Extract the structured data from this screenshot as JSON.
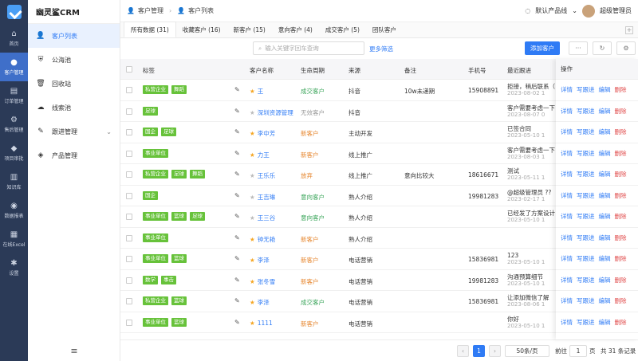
{
  "rail": [
    {
      "label": "首页",
      "icon": "⌂"
    },
    {
      "label": "客户管理",
      "icon": "●"
    },
    {
      "label": "订单管理",
      "icon": "▤"
    },
    {
      "label": "售后管理",
      "icon": "⚙"
    },
    {
      "label": "项目审批",
      "icon": "◆"
    },
    {
      "label": "知识库",
      "icon": "▥"
    },
    {
      "label": "数据报表",
      "icon": "◉"
    },
    {
      "label": "在线Excel",
      "icon": "▦"
    },
    {
      "label": "设置",
      "icon": "✱"
    }
  ],
  "brand": "幽灵鲨CRM",
  "menu": [
    {
      "label": "客户列表",
      "icon": "👤"
    },
    {
      "label": "公海池",
      "icon": "⛨"
    },
    {
      "label": "回收站",
      "icon": "🗑"
    },
    {
      "label": "线索池",
      "icon": "☁"
    },
    {
      "label": "跟进管理",
      "icon": "✎"
    },
    {
      "label": "产品管理",
      "icon": "◈"
    }
  ],
  "breadcrumb": [
    "客户管理",
    "客户列表"
  ],
  "product_line": "默认产品线",
  "user": "超级管理员",
  "tabs": [
    "所有数据 (31)",
    "收藏客户 (16)",
    "新客户 (15)",
    "意向客户 (4)",
    "成交客户 (5)",
    "团队客户"
  ],
  "search_placeholder": "输入关键字回车查询",
  "more_filter": "更多筛选",
  "add_button": "添加客户",
  "columns": {
    "tag": "标签",
    "name": "客户名称",
    "stage": "生命周期",
    "source": "来源",
    "note": "备注",
    "phone": "手机号",
    "last": "最近跟进",
    "ops": "操作"
  },
  "rows": [
    {
      "tags": [
        "私营企业",
        "舞蹈"
      ],
      "star": true,
      "name": "王",
      "stage": "成交客户",
      "stage_color": "green",
      "source": "抖音",
      "note": "10w未递期",
      "phone": "15908891",
      "last": "拒接，稍后联系（",
      "last_date": "2023-08-02 1"
    },
    {
      "tags": [
        "足球"
      ],
      "star": false,
      "name": "深圳资源管理",
      "stage": "无效客户",
      "stage_color": "gray",
      "source": "抖音",
      "note": "",
      "phone": "",
      "last": "客户需要考虑一下",
      "last_date": "2023-08-07 0"
    },
    {
      "tags": [
        "国企",
        "足球"
      ],
      "star": true,
      "name": "李中芳",
      "stage": "新客户",
      "stage_color": "orange",
      "source": "主动开发",
      "note": "",
      "phone": "",
      "last": "已签合同",
      "last_date": "2023-05-10 1"
    },
    {
      "tags": [
        "事业单位"
      ],
      "star": true,
      "name": "力王",
      "stage": "新客户",
      "stage_color": "orange",
      "source": "线上推广",
      "note": "",
      "phone": "",
      "last": "客户需要考虑一下",
      "last_date": "2023-08-03 1"
    },
    {
      "tags": [
        "私营企业",
        "足球",
        "舞蹈"
      ],
      "star": false,
      "name": "王乐乐",
      "stage": "放弃",
      "stage_color": "orange",
      "source": "线上推广",
      "note": "意向比较大",
      "phone": "18616671",
      "last": "测试",
      "last_date": "2023-05-11 1"
    },
    {
      "tags": [
        "国企"
      ],
      "star": false,
      "name": "王吉琳",
      "stage": "意向客户",
      "stage_color": "green",
      "source": "熟人介绍",
      "note": "",
      "phone": "19981283",
      "last": "@超级管理员 ??",
      "last_date": "2023-02-17 1"
    },
    {
      "tags": [
        "事业单位",
        "篮球",
        "足球"
      ],
      "star": false,
      "name": "王三谷",
      "stage": "意向客户",
      "stage_color": "green",
      "source": "熟人介绍",
      "note": "",
      "phone": "",
      "last": "已经发了方案设计",
      "last_date": "2023-05-10 1"
    },
    {
      "tags": [
        "事业单位"
      ],
      "star": true,
      "name": "钟无艳",
      "stage": "新客户",
      "stage_color": "orange",
      "source": "熟人介绍",
      "note": "",
      "phone": "",
      "last": "",
      "last_date": ""
    },
    {
      "tags": [
        "事业单位",
        "篮球"
      ],
      "star": true,
      "name": "李泽",
      "stage": "新客户",
      "stage_color": "orange",
      "source": "电话营销",
      "note": "",
      "phone": "15836981",
      "last": "123",
      "last_date": "2023-05-10 1"
    },
    {
      "tags": [
        "数学",
        "事击"
      ],
      "star": true,
      "name": "张冬雪",
      "stage": "新客户",
      "stage_color": "orange",
      "source": "电话营销",
      "note": "",
      "phone": "19981283",
      "last": "沟通预算细节",
      "last_date": "2023-05-10 1"
    },
    {
      "tags": [
        "私营企业",
        "篮球"
      ],
      "star": true,
      "name": "李泽",
      "stage": "成交客户",
      "stage_color": "green",
      "source": "电话营销",
      "note": "",
      "phone": "15836981",
      "last": "让添加微信了解",
      "last_date": "2023-08-06 1"
    },
    {
      "tags": [
        "事业单位",
        "篮球"
      ],
      "star": true,
      "name": "1111",
      "stage": "新客户",
      "stage_color": "orange",
      "source": "电话营销",
      "note": "",
      "phone": "",
      "last": "你好",
      "last_date": "2023-05-10 1"
    }
  ],
  "ops": [
    "详情",
    "写跟进",
    "编辑",
    "删除"
  ],
  "pager": {
    "current": "1",
    "page_size": "50条/页",
    "goto_label": "前往",
    "goto_value": "1",
    "page_unit": "页",
    "total": "共 31 条记录"
  }
}
